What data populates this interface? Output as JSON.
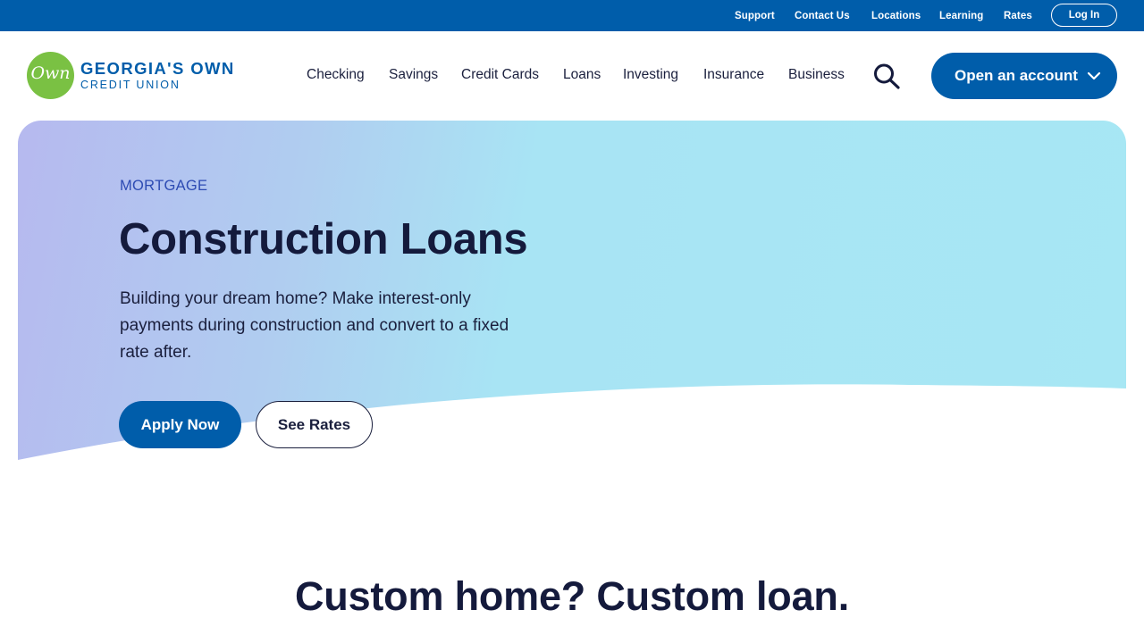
{
  "utility_nav": {
    "links": [
      "Support",
      "Contact Us",
      "Locations",
      "Learning",
      "Rates"
    ],
    "login_label": "Log In"
  },
  "brand": {
    "mark_text": "Own",
    "name": "GEORGIA'S OWN",
    "sub": "CREDIT UNION",
    "primary_color": "#005daa",
    "logo_green": "#7ac143"
  },
  "main_nav": {
    "items": [
      "Checking",
      "Savings",
      "Credit Cards",
      "Loans",
      "Investing",
      "Insurance",
      "Business"
    ],
    "search_icon": "search-icon",
    "cta_label": "Open an account"
  },
  "hero": {
    "eyebrow": "MORTGAGE",
    "title": "Construction Loans",
    "description": "Building your dream home? Make interest-only payments during construction and convert to a fixed rate after.",
    "primary_button": "Apply Now",
    "secondary_button": "See Rates"
  },
  "section": {
    "heading": "Custom home? Custom loan."
  }
}
